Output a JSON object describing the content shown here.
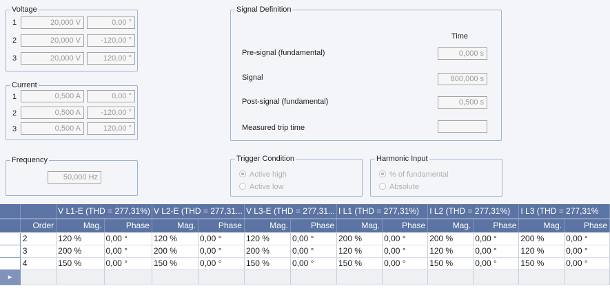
{
  "voltage": {
    "title": "Voltage",
    "rows": [
      {
        "n": "1",
        "mag": "20,000 V",
        "phase": "0,00 °"
      },
      {
        "n": "2",
        "mag": "20,000 V",
        "phase": "-120,00 °"
      },
      {
        "n": "3",
        "mag": "20,000 V",
        "phase": "120,00 °"
      }
    ]
  },
  "current": {
    "title": "Current",
    "rows": [
      {
        "n": "1",
        "mag": "0,500 A",
        "phase": "0,00 °"
      },
      {
        "n": "2",
        "mag": "0,500 A",
        "phase": "-120,00 °"
      },
      {
        "n": "3",
        "mag": "0,500 A",
        "phase": "120,00 °"
      }
    ]
  },
  "frequency": {
    "title": "Frequency",
    "value": "50,000 Hz"
  },
  "signal": {
    "title": "Signal Definition",
    "col_header": "Time",
    "rows": [
      {
        "label": "Pre-signal (fundamental)",
        "value": "0,000 s"
      },
      {
        "label": "Signal",
        "value": "800,000 s"
      },
      {
        "label": "Post-signal (fundamental)",
        "value": "0,500 s"
      },
      {
        "label": "Measured trip time",
        "value": ""
      }
    ]
  },
  "trigger": {
    "title": "Trigger Condition",
    "options": [
      "Active high",
      "Active low"
    ],
    "selected": 0
  },
  "harmonic": {
    "title": "Harmonic Input",
    "options": [
      "% of fundamental",
      "Absolute"
    ],
    "selected": 0
  },
  "table": {
    "group_headers": [
      "V L1-E (THD = 277,31%)",
      "V L2-E (THD = 277,31...",
      "V L3-E (THD = 277,31...",
      "I L1 (THD = 277,31%)",
      "I L2 (THD = 277,31%)",
      "I L3 (THD = 277,31%"
    ],
    "order_header": "Order",
    "sub_headers": [
      "Mag.",
      "Phase"
    ],
    "rows": [
      {
        "order": "2",
        "cells": [
          "120 %",
          "0,00 °",
          "120 %",
          "0,00 °",
          "120 %",
          "0,00 °",
          "200 %",
          "0,00 °",
          "200 %",
          "0,00 °",
          "200 %",
          "0,00 °"
        ]
      },
      {
        "order": "3",
        "cells": [
          "200 %",
          "0,00 °",
          "200 %",
          "0,00 °",
          "200 %",
          "0,00 °",
          "120 %",
          "0,00 °",
          "120 %",
          "0,00 °",
          "120 %",
          "0,00 °"
        ]
      },
      {
        "order": "4",
        "cells": [
          "150 %",
          "0,00 °",
          "150 %",
          "0,00 °",
          "150 %",
          "0,00 °",
          "150 %",
          "0,00 °",
          "150 %",
          "0,00 °",
          "150 %",
          "0,00 °"
        ]
      }
    ],
    "new_row_marker": "►"
  }
}
